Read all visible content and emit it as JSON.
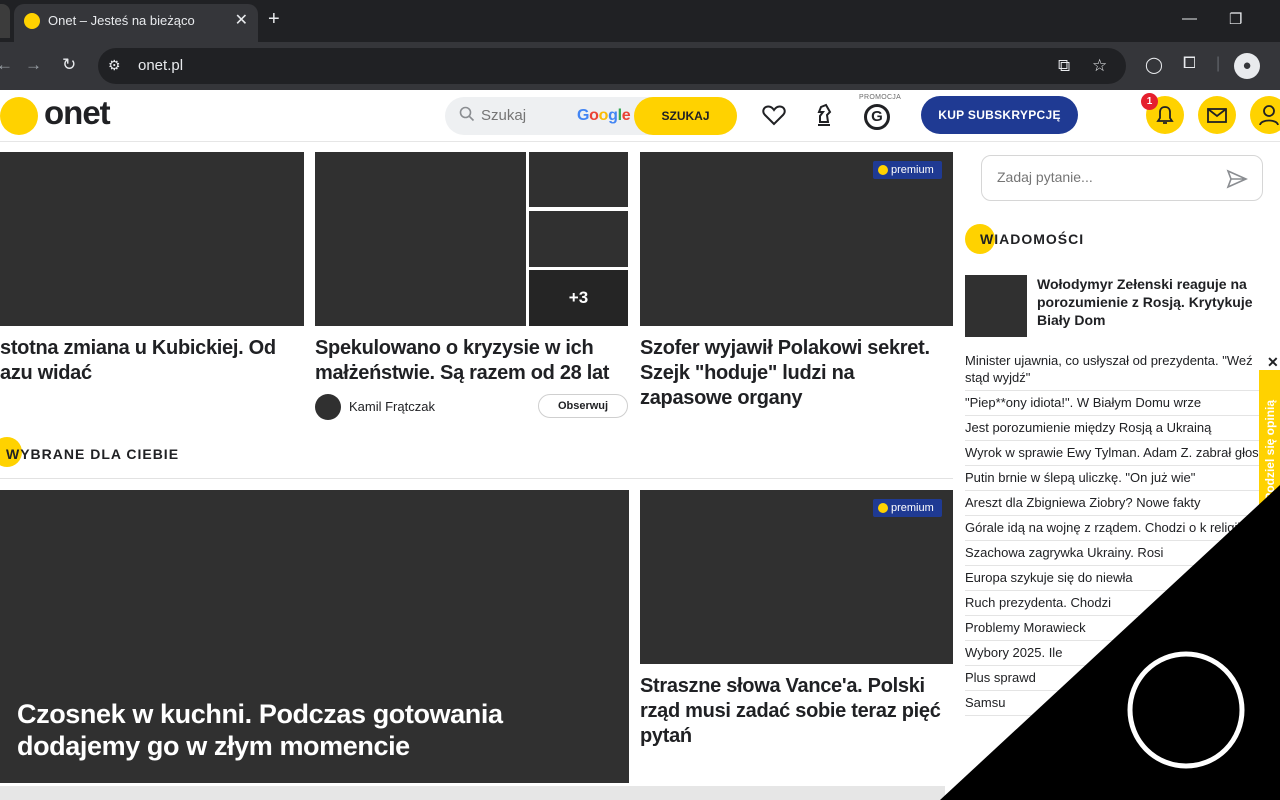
{
  "browser": {
    "tab_title": "Onet – Jesteś na bieżąco",
    "url": "onet.pl",
    "new_tab": "+",
    "close": "✕"
  },
  "header": {
    "logo": "onet",
    "search_placeholder": "Szukaj",
    "search_engine": "Google",
    "search_button": "SZUKAJ",
    "promo_label": "PROMOCJA",
    "promo_icon": "G",
    "subscribe_button": "KUP SUBSKRYPCJĘ",
    "notification_count": "1"
  },
  "articles": {
    "card1_headline": "stotna zmiana u Kubickiej. Od azu widać",
    "card2_headline": "Spekulowano o kryzysie w ich małżeństwie. Są razem od 28 lat",
    "card2_more": "+3",
    "card2_author": "Kamil Frątczak",
    "card2_follow": "Obserwuj",
    "card3_headline": "Szofer wyjawił Polakowi sekret. Szejk \"hoduje\" ludzi na zapasowe organy",
    "card3_badge": "premium",
    "section_title": "WYBRANE DLA CIEBIE",
    "featured_headline": "Czosnek w kuchni. Podczas gotowania dodajemy go w złym momencie",
    "card4_headline": "Straszne słowa Vance'a. Polski rząd musi zadać sobie teraz pięć pytań",
    "card4_badge": "premium"
  },
  "sidebar": {
    "ask_placeholder": "Zadaj pytanie...",
    "section_title": "WIADOMOŚCI",
    "main_news": "Wołodymyr Zełenski reaguje na porozumienie z Rosją. Krytykuje Biały Dom",
    "news": [
      "Minister ujawnia, co usłyszał od prezydenta. \"Weź stąd wyjdź\"",
      "\"Piep**ony idiota!\". W Białym Domu wrze",
      "Jest porozumienie między Rosją a Ukrainą",
      "Wyrok w sprawie Ewy Tylman. Adam Z. zabrał głos",
      "Putin brnie w ślepą uliczkę. \"On już wie\"",
      "Areszt dla Zbigniewa Ziobry? Nowe fakty",
      "Górale idą na wojnę z rządem. Chodzi o k religii",
      "Szachowa zagrywka Ukrainy. Rosi",
      "Europa szykuje się do niewła",
      "Ruch prezydenta. Chodzi",
      "Problemy Morawieck",
      "Wybory 2025. Ile",
      "Plus sprawd",
      "Samsu"
    ],
    "feedback_label": "Podziel się opinią",
    "feedback_close": "✕"
  },
  "colors": {
    "brand_yellow": "#ffd200",
    "brand_navy": "#1f3a93",
    "image_placeholder": "#303030"
  }
}
